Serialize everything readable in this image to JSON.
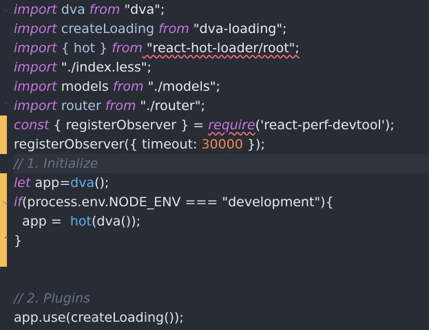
{
  "editor": {
    "lines": [
      {
        "kw": "import",
        "t1": " dva ",
        "kw2": "from",
        "s": " \"dva\";"
      },
      {
        "kw": "import",
        "t1": " createLoading ",
        "kw2": "from",
        "s": " \"dva-loading\";"
      },
      {
        "kw": "import",
        "t1": " { hot } ",
        "kw2": "from",
        "s": " \"react-hot-loader/root\";"
      },
      {
        "kw": "import",
        "s": " \"./index.less\";"
      },
      {
        "kw": "import",
        "t1": " models ",
        "kw2": "from",
        "s": " \"./models\";"
      },
      {
        "kw": "import",
        "t1": " router ",
        "kw2": "from",
        "s": " \"./router\";"
      },
      {
        "kw": "const",
        "t1": " { registerObserver } = ",
        "kw2": "require",
        "s": "('react-perf-devtool');"
      },
      {
        "t1": "registerObserver({ timeout: ",
        "n": "30000",
        "t2": " });"
      },
      {
        "c": "// 1. Initialize"
      },
      {
        "kw": "let",
        "t1": " app=",
        "call": "dva",
        "t2": "();"
      },
      {
        "kw": "if",
        "t1": "(process.env.NODE_ENV === ",
        "s": "\"development\"",
        "t2": "){"
      },
      {
        "t1": "  app =  ",
        "call": "hot",
        "t2": "(dva());"
      },
      {
        "t1": "}"
      },
      {
        "t1": ""
      },
      {
        "t1": ""
      },
      {
        "c": "// 2. Plugins"
      },
      {
        "t1": "app.use(createLoading());"
      }
    ]
  },
  "colors": {
    "background": "#282c34",
    "keyword": "#c678dd",
    "number": "#f08850",
    "comment": "#6a7384",
    "change_marker": "#f4c05a"
  }
}
